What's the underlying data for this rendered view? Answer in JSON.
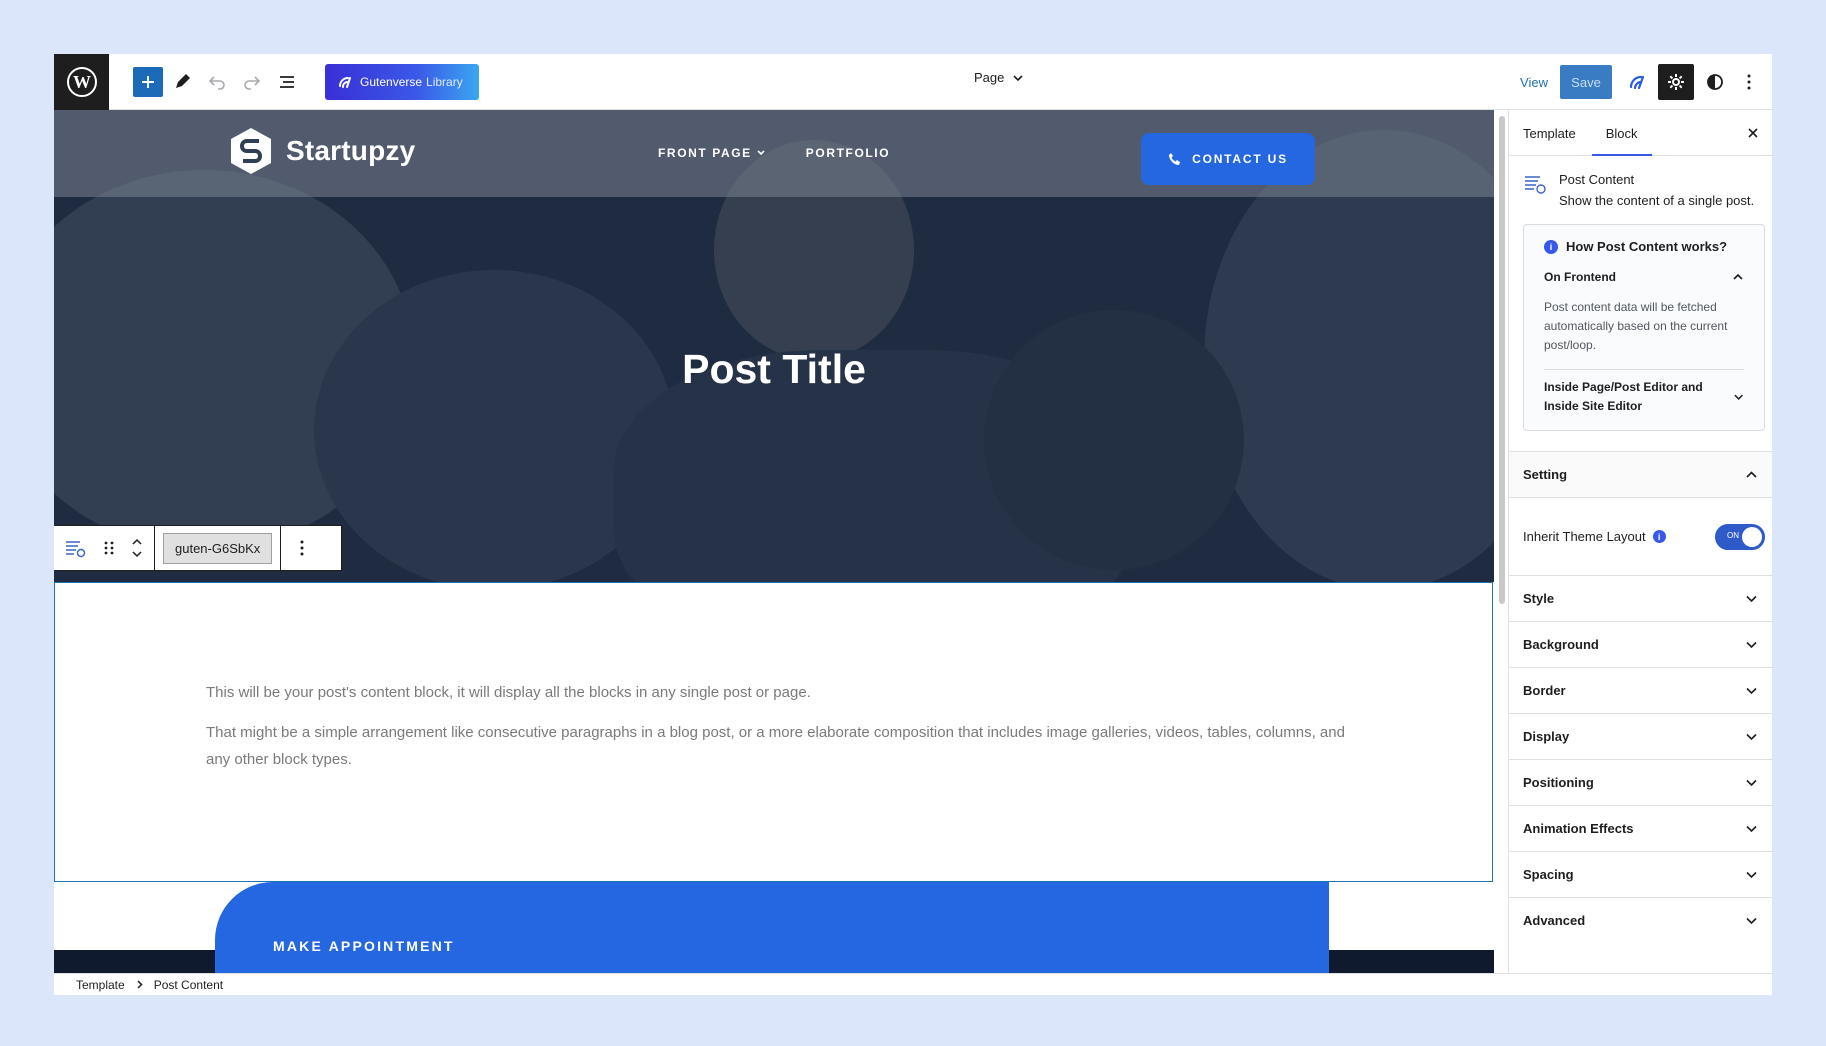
{
  "toolbar": {
    "library_label": "Gutenverse",
    "library_sub": "Library",
    "page_selector": "Page",
    "view_label": "View",
    "save_label": "Save"
  },
  "site": {
    "brand": "Startupzy",
    "nav": [
      {
        "label": "FRONT PAGE",
        "has_dropdown": true
      },
      {
        "label": "PORTFOLIO",
        "has_dropdown": false
      }
    ],
    "cta": "CONTACT US",
    "post_title": "Post Title"
  },
  "block_toolbar": {
    "chip": "guten-G6SbKx"
  },
  "content": {
    "p1": "This will be your post's content block, it will display all the blocks in any single post or page.",
    "p2": "That might be a simple arrangement like consecutive paragraphs in a blog post, or a more elaborate composition that includes image galleries, videos, tables, columns, and any other block types."
  },
  "appointment": {
    "label": "MAKE APPOINTMENT"
  },
  "sidebar": {
    "tabs": [
      "Template",
      "Block"
    ],
    "active_tab": "Block",
    "block": {
      "title": "Post Content",
      "description": "Show the content of a single post."
    },
    "how": {
      "heading": "How Post Content works?",
      "frontend_label": "On Frontend",
      "frontend_desc": "Post content data will be fetched automatically based on the current post/loop.",
      "editor_label": "Inside Page/Post Editor and Inside Site Editor"
    },
    "setting": {
      "title": "Setting",
      "inherit_label": "Inherit Theme Layout",
      "toggle_state": "ON"
    },
    "panels": [
      "Style",
      "Background",
      "Border",
      "Display",
      "Positioning",
      "Animation Effects",
      "Spacing",
      "Advanced"
    ]
  },
  "breadcrumb": [
    "Template",
    "Post Content"
  ],
  "colors": {
    "accent": "#3858e9",
    "cta_blue": "#2467e0",
    "selection": "#2271b1"
  }
}
